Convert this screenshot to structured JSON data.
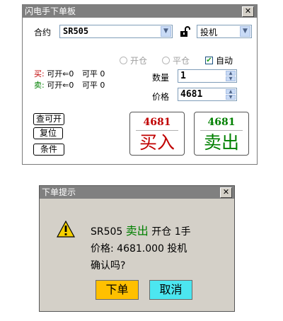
{
  "main_window": {
    "title": "闪电手下单板",
    "close_glyph": "✕",
    "contract_label": "合约",
    "contract_value": "SR505",
    "lock_icon": "lock-open-icon",
    "hedge_value": "投机",
    "position_types": [
      {
        "label": "开仓",
        "selected": false
      },
      {
        "label": "平仓",
        "selected": false
      }
    ],
    "auto_label": "自动",
    "auto_checked": true,
    "buy_line": {
      "prefix": "买:",
      "open_text": "可开⇐0",
      "close_text": "可平 0"
    },
    "sell_line": {
      "prefix": "卖:",
      "open_text": "可开⇐0",
      "close_text": "可平 0"
    },
    "quantity_label": "数量",
    "quantity_value": "1",
    "price_label": "价格",
    "price_value": "4681",
    "buttons": {
      "query": "查可开",
      "reset": "复位",
      "condition": "条件"
    },
    "buy_button": {
      "price": "4681",
      "label": "买入"
    },
    "sell_button": {
      "price": "4681",
      "label": "卖出"
    }
  },
  "dialog": {
    "title": "下单提示",
    "close_glyph": "✕",
    "icon": "warning-icon",
    "line1": {
      "contract": "SR505",
      "action": "卖出",
      "rest": "开仓 1手"
    },
    "line2": "价格: 4681.000 投机",
    "line3": "确认吗?",
    "confirm_label": "下单",
    "cancel_label": "取消"
  },
  "colors": {
    "buy_red": "#c00000",
    "sell_green": "#008000",
    "confirm_bg": "#ffc000",
    "cancel_bg": "#4ce6f0",
    "title_gray": "#808080"
  }
}
